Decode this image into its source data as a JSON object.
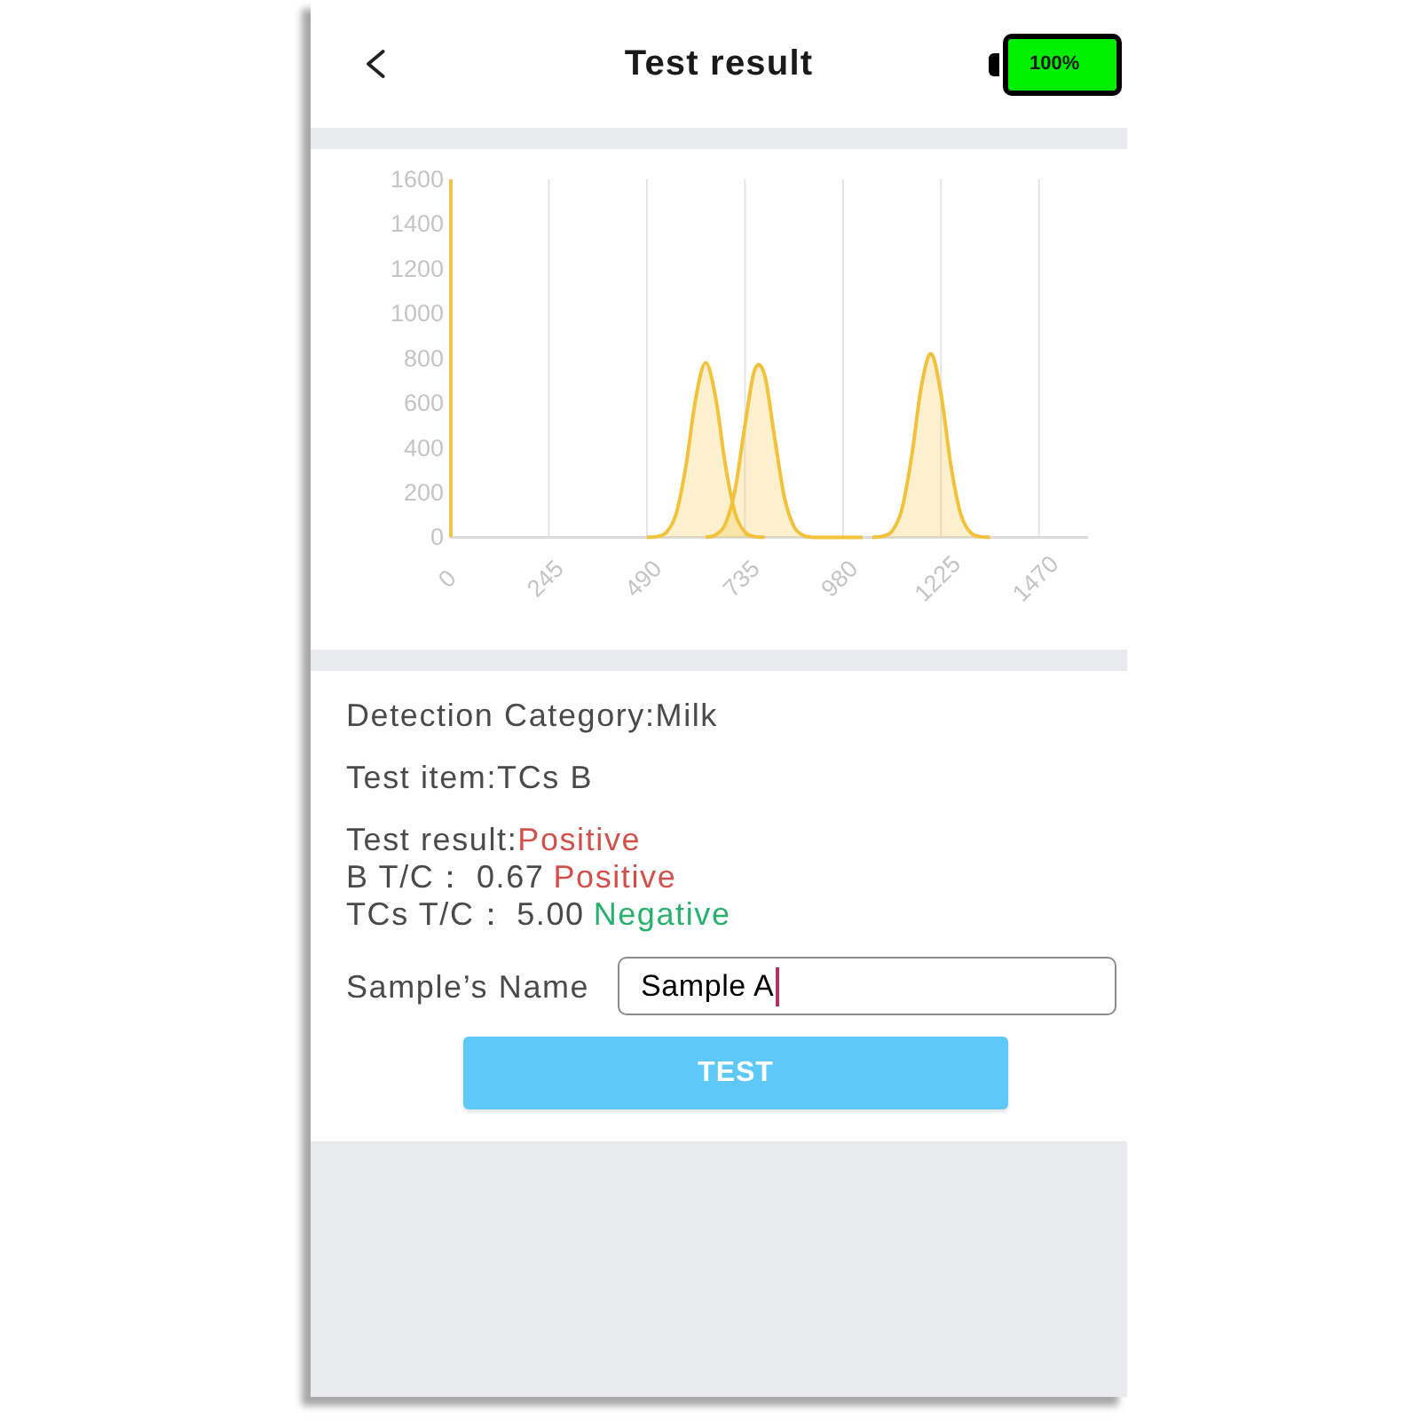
{
  "header": {
    "title": "Test result",
    "battery": {
      "label": "100%"
    }
  },
  "chart": {
    "chart_data": {
      "type": "area",
      "grid": true,
      "x": [
        490,
        514.5,
        539,
        563.5,
        588,
        612.5,
        637,
        661.5,
        686,
        710.5,
        735,
        759.5,
        784,
        808.5,
        833,
        857.5,
        882,
        906.5,
        931,
        955.5,
        980,
        1004.5,
        1029,
        1053.5,
        1078,
        1102.5,
        1127,
        1151.5,
        1176,
        1200.5,
        1225,
        1249.5,
        1274,
        1298.5,
        1323,
        1347.5
      ],
      "series": [
        {
          "color": "#f2c23c",
          "values": [
            0,
            3,
            23,
            108,
            324,
            627,
            780,
            627,
            324,
            108,
            23,
            3,
            0,
            null,
            null,
            null,
            null,
            null,
            null,
            null,
            null,
            null,
            null,
            null,
            null,
            null,
            null,
            null,
            null,
            null,
            null,
            null,
            null,
            null,
            null,
            null
          ]
        },
        {
          "color": "#f2c23c",
          "values": [
            null,
            null,
            null,
            null,
            null,
            null,
            0,
            11,
            59,
            214,
            499,
            749,
            726,
            454,
            183,
            48,
            8,
            0,
            0,
            0,
            0,
            0,
            0,
            null,
            null,
            null,
            null,
            null,
            null,
            null,
            null,
            null,
            null,
            null,
            null,
            null
          ]
        },
        {
          "color": "#f2c23c",
          "values": [
            null,
            null,
            null,
            null,
            null,
            null,
            null,
            null,
            null,
            null,
            null,
            null,
            null,
            null,
            null,
            null,
            null,
            null,
            null,
            null,
            null,
            null,
            null,
            0,
            4,
            27,
            124,
            360,
            676,
            820,
            641,
            323,
            105,
            22,
            3,
            0
          ]
        }
      ],
      "xlim": [
        0,
        1592.5
      ],
      "ylim": [
        0,
        1600
      ],
      "xticks": [
        0,
        245,
        490,
        735,
        980,
        1225,
        1470
      ],
      "yticks": [
        0,
        200,
        400,
        600,
        800,
        1000,
        1200,
        1400,
        1600
      ]
    }
  },
  "details": [
    "Detection Category:Milk",
    "Test item:TCs B"
  ],
  "results": [
    {
      "label": "Test result:",
      "value": "Positive",
      "color": "#d0504c"
    },
    {
      "label": "B T/C：",
      "reading": "0.67",
      "value": "Positive",
      "color": "#d0504c"
    },
    {
      "label": "TCs T/C：",
      "reading": "5.00",
      "value": "Negative",
      "color": "#27b06e"
    }
  ],
  "sample_name": {
    "label": "Sample’s Name",
    "value": "Sample A",
    "focused": true
  },
  "test_button": {
    "label": "TEST"
  }
}
